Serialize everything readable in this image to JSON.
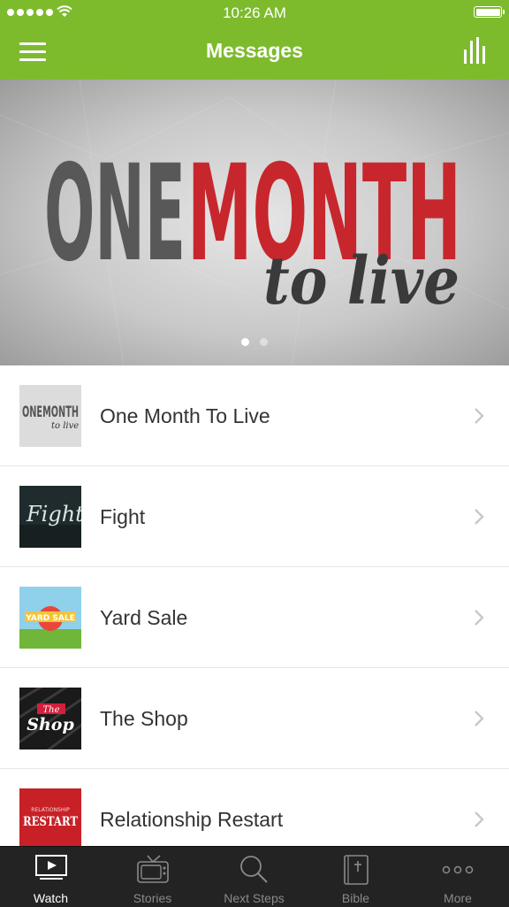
{
  "status_bar": {
    "time": "10:26 AM",
    "signal_dots": 5
  },
  "header": {
    "title": "Messages",
    "menu_icon": "hamburger-menu-icon",
    "right_icon": "bar-chart-icon",
    "background_color": "#7dbb2d"
  },
  "hero": {
    "title_line_1a": "ONE",
    "title_line_1b": "MONTH",
    "title_line_2": "to live",
    "page_count": 2,
    "active_page": 1
  },
  "messages": [
    {
      "label": "One Month To Live",
      "thumb_text": "ONEMONTH",
      "thumb_sub": "to live"
    },
    {
      "label": "Fight",
      "thumb_text": "Fight"
    },
    {
      "label": "Yard Sale",
      "thumb_text": "YARD SALE"
    },
    {
      "label": "The Shop",
      "thumb_text_a": "The",
      "thumb_text_b": "Shop"
    },
    {
      "label": "Relationship Restart",
      "thumb_text_a": "RELATIONSHIP",
      "thumb_text_b": "RESTART"
    }
  ],
  "tabbar": {
    "tabs": [
      {
        "label": "Watch",
        "icon": "play-screen-icon",
        "active": true
      },
      {
        "label": "Stories",
        "icon": "tv-icon",
        "active": false
      },
      {
        "label": "Next Steps",
        "icon": "search-icon",
        "active": false
      },
      {
        "label": "Bible",
        "icon": "bible-icon",
        "active": false
      },
      {
        "label": "More",
        "icon": "more-dots-icon",
        "active": false
      }
    ]
  },
  "colors": {
    "accent": "#7dbb2d",
    "hero_red": "#c8262d",
    "hero_gray": "#555555",
    "tabbar_bg": "#232323"
  }
}
